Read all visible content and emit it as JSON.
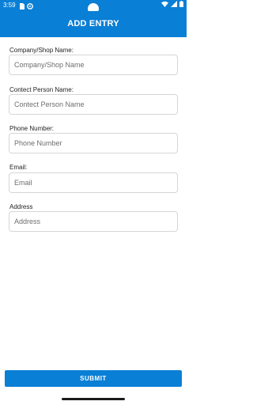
{
  "status_bar": {
    "time": "3:59",
    "left_icons": [
      "sim-card-icon",
      "settings-gear-icon"
    ],
    "right_icons": [
      "wifi-icon",
      "signal-icon",
      "battery-icon"
    ]
  },
  "app_bar": {
    "title": "ADD ENTRY"
  },
  "form": {
    "fields": [
      {
        "label": "Company/Shop Name:",
        "placeholder": "Company/Shop Name",
        "value": ""
      },
      {
        "label": "Contect Person Name:",
        "placeholder": "Contect Person Name",
        "value": ""
      },
      {
        "label": "Phone Number:",
        "placeholder": "Phone Number",
        "value": ""
      },
      {
        "label": "Email:",
        "placeholder": "Email",
        "value": ""
      },
      {
        "label": "Address",
        "placeholder": "Address",
        "value": ""
      }
    ]
  },
  "submit": {
    "label": "SUBMIT"
  },
  "colors": {
    "primary": "#0a7fd6",
    "on_primary": "#ffffff",
    "border": "#d6d6d6"
  }
}
